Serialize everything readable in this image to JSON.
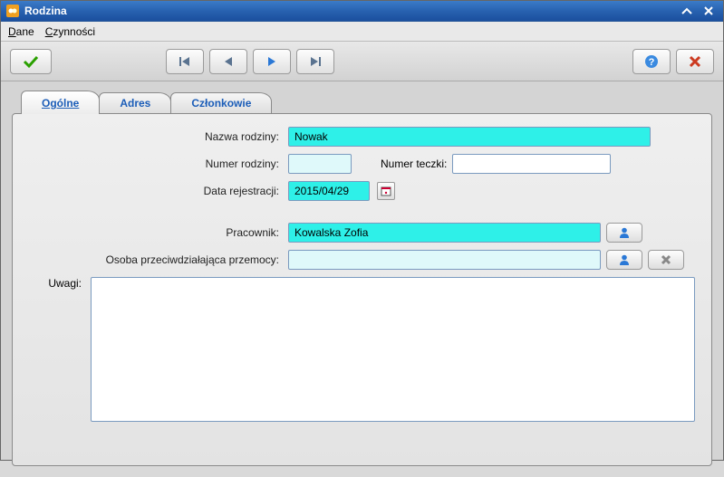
{
  "window": {
    "title": "Rodzina"
  },
  "menu": {
    "dane": "Dane",
    "czynnosci": "Czynności"
  },
  "tabs": {
    "ogolne": "Ogólne",
    "adres": "Adres",
    "czlonkowie": "Członkowie"
  },
  "labels": {
    "nazwa_rodziny": "Nazwa rodziny:",
    "numer_rodziny": "Numer rodziny:",
    "numer_teczki": "Numer teczki:",
    "data_rejestracji": "Data rejestracji:",
    "pracownik": "Pracownik:",
    "osoba_przeciw": "Osoba przeciwdziałająca przemocy:",
    "uwagi": "Uwagi:"
  },
  "values": {
    "nazwa_rodziny": "Nowak",
    "numer_rodziny": "",
    "numer_teczki": "",
    "data_rejestracji": "2015/04/29",
    "pracownik": "Kowalska Zofia",
    "osoba_przeciw": "",
    "uwagi": ""
  }
}
